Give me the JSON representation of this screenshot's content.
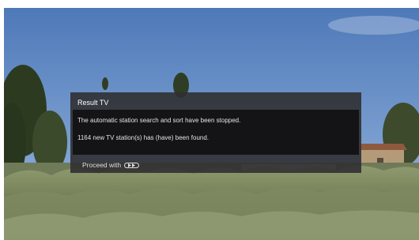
{
  "dialog": {
    "title": "Result TV",
    "message_line1": "The automatic station search and sort have been stopped.",
    "message_line2": "1164 new TV station(s) has (have) been found.",
    "footer_label": "Proceed with",
    "footer_icon": "ok-button-icon"
  }
}
